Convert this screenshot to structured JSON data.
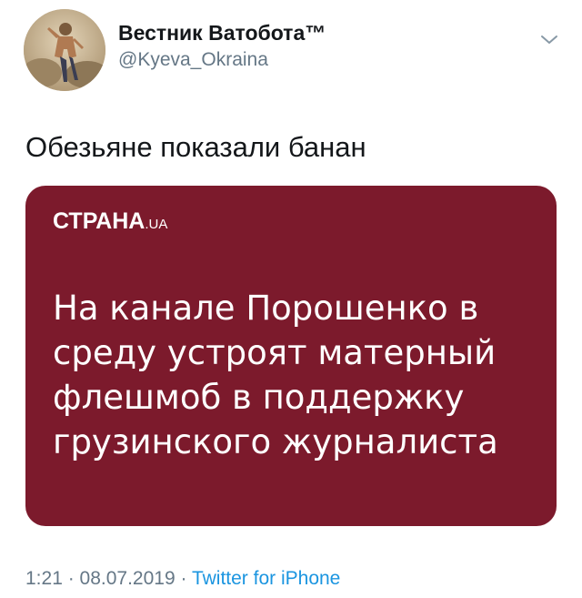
{
  "user": {
    "display_name": "Вестник Ватобота™",
    "handle": "@Kyeva_Okraina",
    "avatar_icon": "user-photo-avatar"
  },
  "tweet": {
    "text": "Обезьяне показали банан"
  },
  "media": {
    "logo_main": "СТРАНА",
    "logo_suffix": ".UA",
    "headline_lines": [
      "На канале Порошенко в",
      "среду устроят матерный",
      "флешмоб в поддержку",
      "грузинского журналиста"
    ],
    "background_color": "#7c1a2c"
  },
  "meta": {
    "time": "1:21",
    "separator": " · ",
    "date": "08.07.2019",
    "source": "Twitter for iPhone"
  },
  "colors": {
    "text_primary": "#14171a",
    "text_secondary": "#657786",
    "link": "#1b95e0"
  },
  "icons": {
    "menu": "chevron-down-icon"
  }
}
